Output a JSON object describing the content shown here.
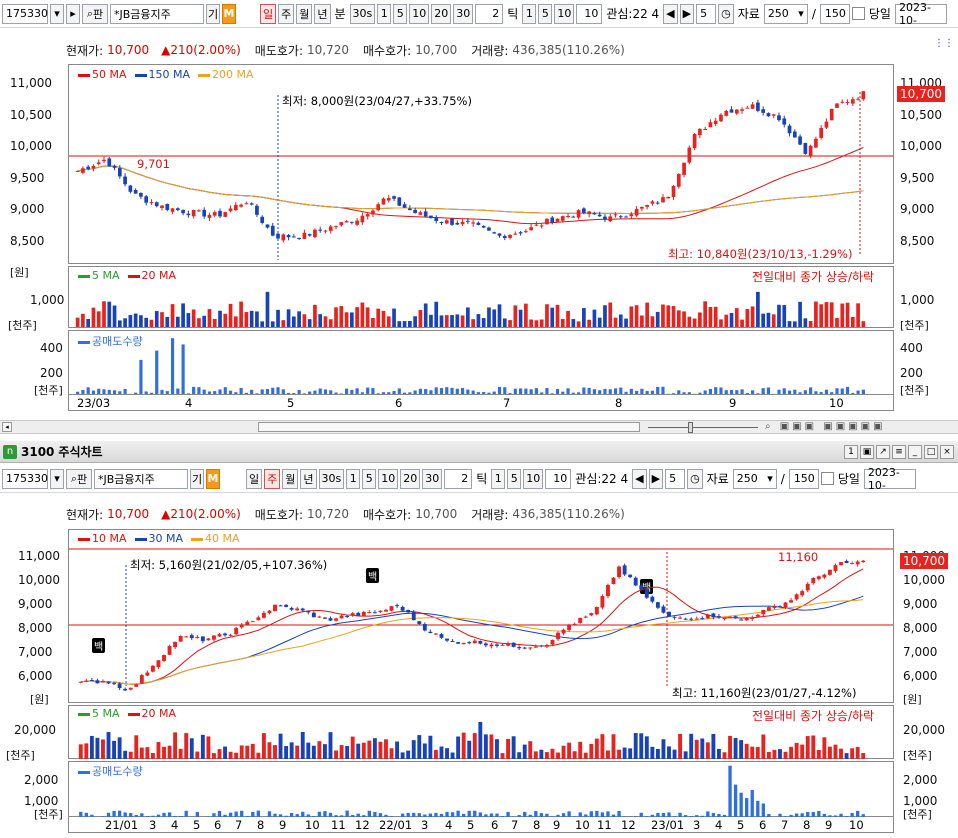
{
  "toolbar": {
    "code": "175330",
    "name": "*JB금융지주",
    "gi_label": "기",
    "m_label": "M",
    "periods": [
      "일",
      "주",
      "월",
      "년",
      "분"
    ],
    "minutes": [
      "30s",
      "1",
      "5",
      "10",
      "20",
      "30"
    ],
    "tick_value": "2",
    "tick_label": "틱",
    "ticks": [
      "1",
      "5",
      "10"
    ],
    "tick_count": "10",
    "gwansim": "관심:22 4",
    "count_value": "5",
    "jaryo_label": "자료",
    "data_count": "250",
    "slash": "/",
    "total_count": "150",
    "dangil_label": "당일",
    "date": "2023-10-"
  },
  "info": {
    "price_label": "현재가:",
    "price": "10,700",
    "change": "▲210(2.00%)",
    "ask_label": "매도호가:",
    "ask": "10,720",
    "bid_label": "매수호가:",
    "bid": "10,700",
    "vol_label": "거래량:",
    "vol": "436,385(110.26%)"
  },
  "top_chart": {
    "ma_legend": [
      {
        "name": "50 MA",
        "color": "#d11"
      },
      {
        "name": "150 MA",
        "color": "#1843b8"
      },
      {
        "name": "200 MA",
        "color": "#f0a020"
      }
    ],
    "price_axis": [
      "11,000",
      "10,500",
      "10,000",
      "9,500",
      "9,000",
      "8,500",
      "[원]"
    ],
    "current_price_tag": "10,700",
    "low_annotation": "최저: 8,000원(23/04/27,+33.75%)",
    "high_annotation": "최고: 10,840원(23/10/13,-1.29%)",
    "level_label": "9,701",
    "vol_legend": [
      {
        "name": "5 MA",
        "color": "#28a028"
      },
      {
        "name": "20 MA",
        "color": "#d11"
      }
    ],
    "vol_note": "전일대비 종가 상승/하락",
    "vol_axis": [
      "1,000",
      "[천주]"
    ],
    "short_legend": "공매도수량",
    "short_axis": [
      "400",
      "200",
      "[천주]"
    ],
    "x_labels": [
      "23/03",
      "4",
      "5",
      "6",
      "7",
      "8",
      "9",
      "10"
    ]
  },
  "bottom_window": {
    "title_code": "3100",
    "title": "주식차트"
  },
  "bottom_chart": {
    "ma_legend": [
      {
        "name": "10 MA",
        "color": "#d11"
      },
      {
        "name": "30 MA",
        "color": "#1843b8"
      },
      {
        "name": "40 MA",
        "color": "#f0a020"
      }
    ],
    "price_axis": [
      "11,000",
      "10,000",
      "9,000",
      "8,000",
      "7,000",
      "6,000",
      "[원]"
    ],
    "current_price_tag": "10,700",
    "low_annotation": "최저: 5,160원(21/02/05,+107.36%)",
    "high_annotation": "최고: 11,160원(23/01/27,-4.12%)",
    "high_level_label": "11,160",
    "baek_label": "백",
    "vol_legend": [
      {
        "name": "5 MA",
        "color": "#28a028"
      },
      {
        "name": "20 MA",
        "color": "#d11"
      }
    ],
    "vol_note": "전일대비 종가 상승/하락",
    "vol_axis": [
      "20,000",
      "[천주]"
    ],
    "short_legend": "공매도수량",
    "short_axis": [
      "2,000",
      "1,000",
      "[천주]"
    ],
    "x_labels": [
      "21/01",
      "3",
      "4",
      "5",
      "6",
      "7",
      "8",
      "9",
      "10",
      "11",
      "12",
      "22/01",
      "3",
      "4",
      "5",
      "6",
      "7",
      "8",
      "9",
      "10",
      "11",
      "12",
      "23/01",
      "3",
      "4",
      "5",
      "6",
      "7",
      "8",
      "9",
      "10"
    ]
  },
  "colors": {
    "up": "#e8221e",
    "down": "#1843b8",
    "accent": "#f39a1b"
  }
}
